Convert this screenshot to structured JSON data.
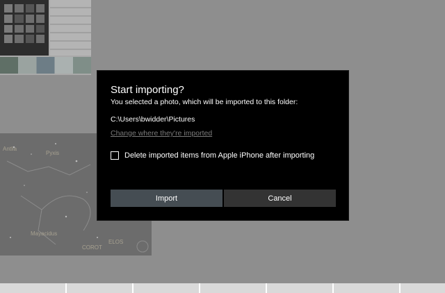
{
  "dialog": {
    "title": "Start importing?",
    "subtitle": "You selected a photo, which will be imported to this folder:",
    "folder_path": "C:\\Users\\bwidder\\Pictures",
    "change_link": "Change where they're imported",
    "delete_checkbox": {
      "label": "Delete imported items from Apple iPhone after importing",
      "checked": false
    },
    "import_label": "Import",
    "cancel_label": "Cancel"
  },
  "background": {
    "star_labels": [
      "Antlia",
      "Pyxis",
      "Mayacidus",
      "COROT",
      "ELOS"
    ]
  },
  "colors": {
    "overlay": "#8e8e8e",
    "dialog_bg": "#000000",
    "import_button": "#454d53",
    "cancel_button": "#333333",
    "link": "#7a7a7a"
  }
}
